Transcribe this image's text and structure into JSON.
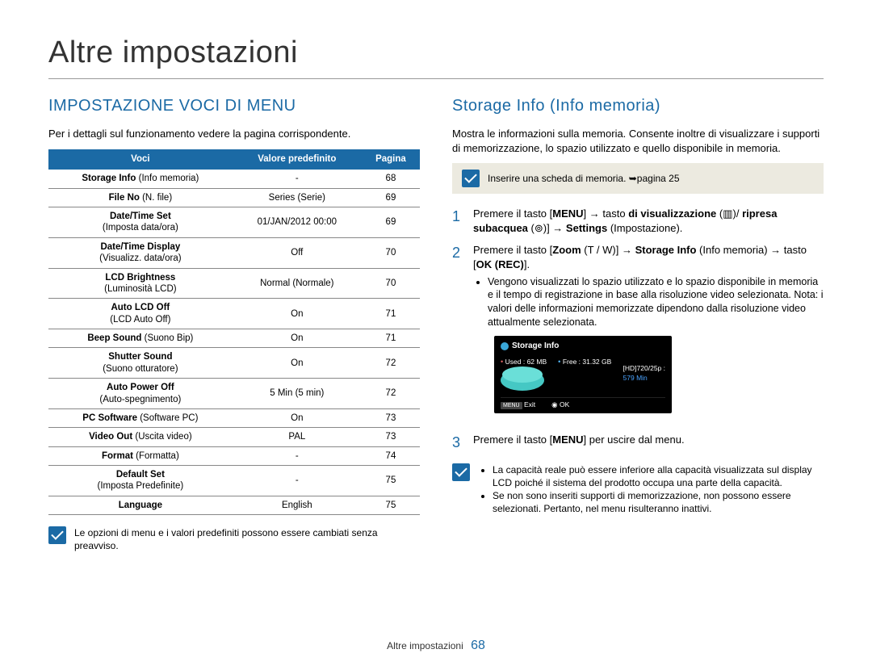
{
  "page_title": "Altre impostazioni",
  "left": {
    "heading": "IMPOSTAZIONE VOCI DI MENU",
    "intro": "Per i dettagli sul funzionamento vedere la pagina corrispondente.",
    "table": {
      "headers": {
        "col1": "Voci",
        "col2": "Valore predefinito",
        "col3": "Pagina"
      },
      "rows": [
        {
          "main": "Storage Info",
          "sub": " (Info memoria)",
          "val": "-",
          "page": "68"
        },
        {
          "main": "File No",
          "sub": " (N. file)",
          "val": "Series (Serie)",
          "page": "69"
        },
        {
          "main": "Date/Time Set",
          "sub2": "(Imposta data/ora)",
          "val": "01/JAN/2012 00:00",
          "page": "69"
        },
        {
          "main": "Date/Time Display",
          "sub2": "(Visualizz. data/ora)",
          "val": "Off",
          "page": "70"
        },
        {
          "main": "LCD Brightness",
          "sub2": "(Luminosità LCD)",
          "val": "Normal (Normale)",
          "page": "70"
        },
        {
          "main": "Auto LCD Off",
          "sub2": "(LCD Auto Off)",
          "val": "On",
          "page": "71"
        },
        {
          "main": "Beep Sound",
          "sub": " (Suono Bip)",
          "val": "On",
          "page": "71"
        },
        {
          "main": "Shutter Sound",
          "sub2": "(Suono otturatore)",
          "val": "On",
          "page": "72"
        },
        {
          "main": "Auto Power Off",
          "sub2": "(Auto-spegnimento)",
          "val": "5 Min (5 min)",
          "page": "72"
        },
        {
          "main": "PC Software",
          "sub": " (Software PC)",
          "val": "On",
          "page": "73"
        },
        {
          "main": "Video Out",
          "sub": " (Uscita video)",
          "val": "PAL",
          "page": "73"
        },
        {
          "main": "Format",
          "sub": " (Formatta)",
          "val": "-",
          "page": "74"
        },
        {
          "main": "Default Set",
          "sub2": "(Imposta Predefinite)",
          "val": "-",
          "page": "75"
        },
        {
          "main": "Language",
          "sub": "",
          "val": "English",
          "page": "75"
        }
      ]
    },
    "note": "Le opzioni di menu e i valori predefiniti possono essere cambiati senza preavviso."
  },
  "right": {
    "heading": "Storage Info (Info memoria)",
    "intro": "Mostra le informazioni sulla memoria. Consente inoltre di visualizzare i supporti di memorizzazione, lo spazio utilizzato e quello disponibile in memoria.",
    "callout": "Inserire una scheda di memoria. ➥pagina 25",
    "step1_a": "Premere il tasto [",
    "step1_menu": "MENU",
    "step1_b": "] → tasto ",
    "step1_c": "di visualizzazione",
    "step1_d": " (▥)/ ",
    "step1_e": "ripresa subacquea",
    "step1_f": " (⊚)] → ",
    "step1_g": "Settings",
    "step1_h": " (Impostazione).",
    "step2_a": "Premere il tasto [",
    "step2_zoom": "Zoom",
    "step2_tw": " (T / W)",
    "step2_b": "] → ",
    "step2_si": "Storage Info",
    "step2_c": " (Info memoria) → tasto [",
    "step2_ok": "OK (REC)",
    "step2_d": "].",
    "step2_bullet": "Vengono visualizzati lo spazio utilizzato e lo spazio disponibile in memoria e il tempo di registrazione in base alla risoluzione video selezionata. Nota: i valori delle informazioni memorizzate dipendono dalla risoluzione video attualmente selezionata.",
    "lcd": {
      "title": "Storage Info",
      "used_label": "Used : 62 MB",
      "free_label": "Free : 31.32 GB",
      "res": "[HD]720/25p :",
      "mins": "579 Min",
      "exit": "Exit",
      "ok": "OK"
    },
    "step3_a": "Premere il tasto [",
    "step3_menu": "MENU",
    "step3_b": "] per uscire dal menu.",
    "footnote1": "La capacità reale può essere inferiore alla capacità visualizzata sul display LCD poiché il sistema del prodotto occupa una parte della capacità.",
    "footnote2": "Se non sono inseriti supporti di memorizzazione, non possono essere selezionati. Pertanto, nel menu risulteranno inattivi."
  },
  "footer": {
    "label": "Altre impostazioni",
    "page": "68"
  }
}
